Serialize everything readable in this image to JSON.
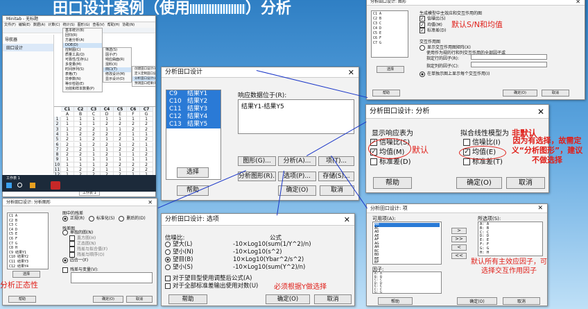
{
  "banner": {
    "title_left": "田口设计案例（使用",
    "title_right": "）分析"
  },
  "minitab": {
    "title": "Minitab - 无标题",
    "menubar": [
      "文件(F)",
      "编辑(E)",
      "数据(A)",
      "计算(C)",
      "统计(S)",
      "图形(G)",
      "查看(V)",
      "帮助(H)",
      "协助(N)"
    ],
    "nav_header": "导航器",
    "nav_item": "田口设计",
    "stat_menu": [
      "基本统计(B)",
      "回归(R)",
      "方差分析(A)",
      "DOE(D)",
      "控制图(C)",
      "质量工具(Q)",
      "可靠性/生存(L)",
      "多变量(M)",
      "时间序列(S)",
      "表格(T)",
      "非参数(N)",
      "等价检验(E)",
      "功效和样本数量(P)"
    ],
    "doe_menu": [
      "筛选(S)",
      "因子(F)",
      "响应曲面(R)",
      "混料(X)",
      "田口(T)",
      "修改设计(M)",
      "显示设计(D)"
    ],
    "taguchi_menu": [
      "创建田口设计(C)...",
      "定义定制田口设计(D)...",
      "分析田口设计(A)...",
      "预测田口结果(P)..."
    ],
    "sheet_tab": "工作表 1",
    "columns": [
      "C1",
      "C2",
      "C3",
      "C4",
      "C5",
      "C6",
      "C7"
    ],
    "col_names": [
      "A",
      "B",
      "C",
      "D",
      "E",
      "F",
      "G"
    ],
    "rows": [
      [
        "1",
        "1",
        "1",
        "1",
        "1",
        "1",
        "1"
      ],
      [
        "1",
        "1",
        "1",
        "2",
        "2",
        "2",
        "2"
      ],
      [
        "1",
        "2",
        "2",
        "1",
        "1",
        "2",
        "2"
      ],
      [
        "1",
        "2",
        "2",
        "2",
        "2",
        "1",
        "1"
      ],
      [
        "2",
        "1",
        "2",
        "1",
        "2",
        "1",
        "2"
      ],
      [
        "2",
        "1",
        "2",
        "2",
        "1",
        "2",
        "1"
      ],
      [
        "2",
        "2",
        "1",
        "1",
        "2",
        "2",
        "1"
      ],
      [
        "2",
        "2",
        "1",
        "2",
        "1",
        "1",
        "2"
      ],
      [
        "1",
        "1",
        "1",
        "1",
        "1",
        "1",
        "1"
      ],
      [
        "1",
        "1",
        "1",
        "2",
        "2",
        "2",
        "2"
      ],
      [
        "1",
        "2",
        "2",
        "1",
        "1",
        "2",
        "2"
      ],
      [
        "1",
        "2",
        "2",
        "2",
        "2",
        "1",
        "1"
      ],
      [
        "2",
        "1",
        "2",
        "1",
        "2",
        "1",
        "2"
      ],
      [
        "2",
        "1",
        "2",
        "2",
        "1",
        "2",
        "1"
      ]
    ],
    "taskbar_label": "工作表 1"
  },
  "main_dialog": {
    "title": "分析田口设计",
    "list": [
      {
        "col": "C9",
        "name": "结果Y1"
      },
      {
        "col": "C10",
        "name": "结果Y2"
      },
      {
        "col": "C11",
        "name": "结果Y3"
      },
      {
        "col": "C12",
        "name": "结果Y4"
      },
      {
        "col": "C13",
        "name": "结果Y5"
      }
    ],
    "response_label": "响应数据位于(R):",
    "response_value": "结果Y1-结果Y5",
    "buttons": {
      "select": "选择",
      "graph": "图形(G)...",
      "analysis": "分析(A)...",
      "terms": "项(T)...",
      "analysis_graph": "分析图形(R)...",
      "options": "选项(P)...",
      "storage": "存储(S)...",
      "help": "帮助",
      "ok": "确定(O)",
      "cancel": "取消"
    }
  },
  "graph_dialog": {
    "title": "分析田口设计: 图形",
    "heading": "生成模型中主效应和交互作用的图",
    "checks": [
      "信噪比(S)",
      "均值(M)",
      "标准差(D)"
    ],
    "interaction_heading": "交互作用图",
    "interaction_opts": [
      "显示交互作用图矩阵(X)",
      "使用作为规的行和列交互作用的全部因子或"
    ],
    "specify1": "指定行的因子(R):",
    "specify2": "指定列的因子(C):",
    "radio_last": "在单独示图上显示每个交互作用(I)",
    "list": [
      "C1 A",
      "C2 B",
      "C3 C",
      "C4 D",
      "C5 E",
      "C6 F",
      "C7 G"
    ],
    "select": "选择",
    "help": "帮助",
    "ok": "确定(O)",
    "cancel": "取消",
    "annotation": "默认S/N和均值"
  },
  "analysis_dialog": {
    "title": "分析田口设计: 分析",
    "left_heading": "显示响应表为",
    "left": [
      "信噪比(S)",
      "均值(M)",
      "标准差(D)"
    ],
    "right_heading": "拟合线性模型为",
    "right": [
      "信噪比(I)",
      "均值(E)",
      "标准差(T)"
    ],
    "help": "帮助",
    "ok": "确定(O)",
    "cancel": "取消",
    "annotation_default": "默认",
    "annotation_nondefault": "非默认",
    "annotation_note": "因为有选择，故需定义“分析图形”，建议不做选择"
  },
  "analysis_graph_dialog": {
    "title": "分析田口设计: 分析图形",
    "residuals_heading": "图中的残差",
    "residual_opts": [
      "正规(R)",
      "标准化(S)",
      "删后的(D)"
    ],
    "plots_heading": "残差图",
    "plot_opts": [
      "单独的图(N)",
      "直方图(H)",
      "正态图(N)",
      "残差与拟合值(F)",
      "残差与顺序(O)",
      "四合一(F)"
    ],
    "vs_variables": "残差与变量(V):",
    "list": [
      "C1 A",
      "C2 B",
      "C3 C",
      "C4 D",
      "C5 E",
      "C6 F",
      "C7 G",
      "C8 H",
      "C9 结果Y1",
      "C10 结果Y2",
      "C11 结果Y3",
      "C12 结果Y4"
    ],
    "select": "选择",
    "help": "帮助",
    "ok": "确定(O)",
    "cancel": "取消",
    "annotation": "分析正态性"
  },
  "options_dialog": {
    "title": "分析田口设计: 选项",
    "sn_label": "信噪比:",
    "formula_label": "公式",
    "options": [
      {
        "label": "望大(L)",
        "formula": "-10×Log10(sum(1/Y^2)/n)"
      },
      {
        "label": "望小(N)",
        "formula": "-10×Log10(s^2)"
      },
      {
        "label": "望目(B)",
        "formula": "10×Log10(Ybar^2/s^2)"
      },
      {
        "label": "望小(S)",
        "formula": "-10×Log10(sum(Y^2)/n)"
      }
    ],
    "check1": "对于望目型使用调整后公式(A)",
    "check2": "对于全部标准差输出使用对数(U)",
    "annotation": "必须根据Y做选择",
    "help": "帮助",
    "ok": "确定(O)",
    "cancel": "取消"
  },
  "terms_dialog": {
    "title": "分析田口设计: 项",
    "available_label": "可用项(A):",
    "selected_label": "所选项(S):",
    "available": [
      "AB",
      "AC",
      "AD",
      "AE",
      "AF",
      "AG",
      "AH",
      "BC",
      "BD",
      "BE",
      "BF"
    ],
    "selected": [
      "A: A",
      "B: B",
      "C: C",
      "D: D",
      "E: E",
      "F: F",
      "G: G",
      "H: H"
    ],
    "factors_label": "因子:",
    "factors": [
      "A: A",
      "B: B",
      "C: C",
      "D: D",
      "E: E",
      "F: F",
      "G: G"
    ],
    "move": [
      ">",
      ">>",
      "<",
      "<<"
    ],
    "help": "帮助",
    "ok": "确定(O)",
    "cancel": "取消",
    "annotation": "默认所有主效应因子，可选择交互作用因子"
  },
  "colors": {
    "accent_red": "#e0201a",
    "arrow_blue": "#1a36c8",
    "selection": "#2a7ad6"
  }
}
